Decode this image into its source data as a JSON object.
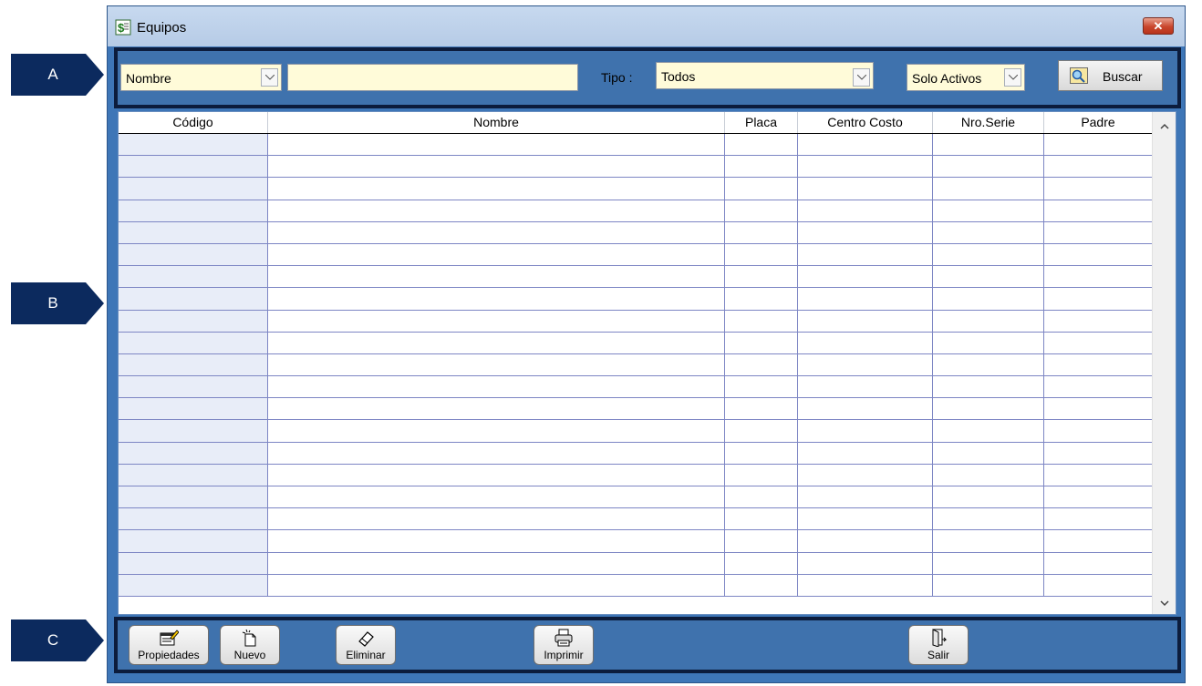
{
  "markers": {
    "a": "A",
    "b": "B",
    "c": "C"
  },
  "window": {
    "title": "Equipos",
    "close_glyph": "✕"
  },
  "toolbar": {
    "field_combo": "Nombre",
    "search_value": "",
    "tipo_label": "Tipo :",
    "tipo_combo": "Todos",
    "estado_combo": "Solo Activos",
    "buscar_label": "Buscar"
  },
  "grid": {
    "columns": [
      "Código",
      "Nombre",
      "Placa",
      "Centro Costo",
      "Nro.Serie",
      "Padre"
    ]
  },
  "actions": {
    "propiedades": "Propiedades",
    "nuevo": "Nuevo",
    "eliminar": "Eliminar",
    "imprimir": "Imprimir",
    "salir": "Salir"
  },
  "colors": {
    "marker_fill": "#0c2a5e",
    "panel_blue": "#3f72ad",
    "panel_border": "#0c1c3c",
    "input_bg": "#fffbd9",
    "first_col_bg": "#e8edf8",
    "grid_line": "#7d86c4"
  },
  "icons": [
    "app-icon",
    "close-icon",
    "chevron-down-icon",
    "search-icon",
    "scroll-up-icon",
    "scroll-down-icon",
    "properties-icon",
    "new-document-icon",
    "eraser-icon",
    "printer-icon",
    "exit-door-icon"
  ]
}
